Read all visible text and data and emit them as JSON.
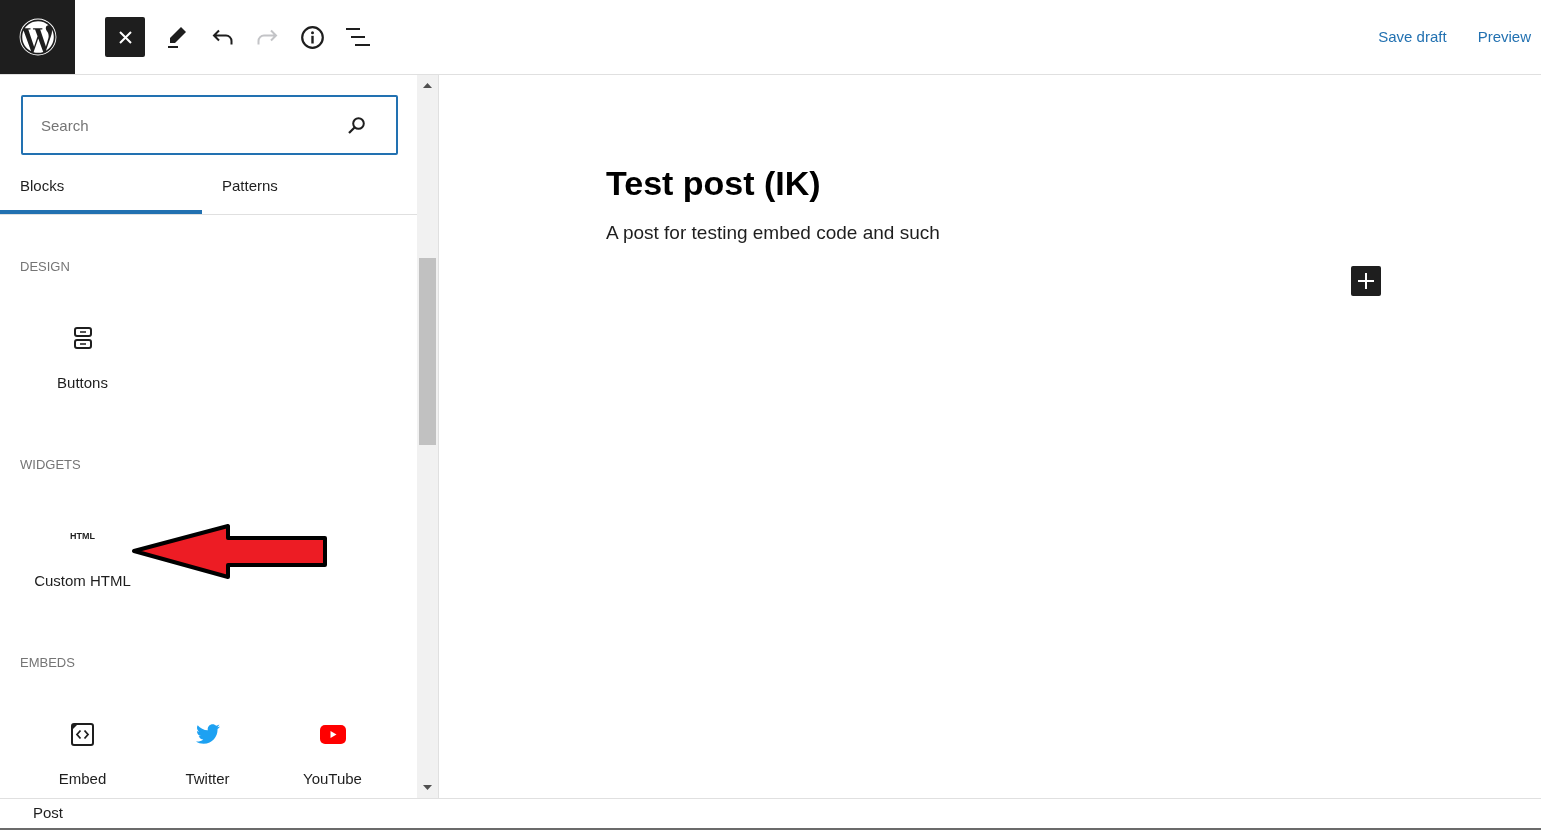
{
  "toolbar": {
    "inserter_toggle": {
      "active": true
    },
    "tools": [
      {
        "kind": "edit",
        "disabled": false
      },
      {
        "kind": "undo",
        "disabled": false
      },
      {
        "kind": "redo",
        "disabled": true
      },
      {
        "kind": "info",
        "disabled": false
      },
      {
        "kind": "list_view",
        "disabled": false
      }
    ],
    "actions": [
      "Save draft",
      "Preview"
    ]
  },
  "inserter": {
    "search": {
      "placeholder": "Search"
    },
    "tabs": [
      {
        "label": "Blocks",
        "selected": true
      },
      {
        "label": "Patterns",
        "selected": false
      }
    ],
    "sections": [
      {
        "title": "DESIGN",
        "blocks": [
          {
            "kind": "buttons",
            "label": "Buttons"
          }
        ]
      },
      {
        "title": "WIDGETS",
        "blocks": [
          {
            "kind": "html",
            "icon_text": "HTML",
            "label": "Custom HTML"
          }
        ]
      },
      {
        "title": "EMBEDS",
        "blocks": [
          {
            "kind": "embed",
            "label": "Embed"
          },
          {
            "kind": "twitter",
            "label": "Twitter"
          },
          {
            "kind": "youtube",
            "label": "YouTube"
          }
        ]
      }
    ]
  },
  "editor": {
    "title": "Test post (IK)",
    "paragraph": "A post for testing embed code and such"
  },
  "status_bar": {
    "breadcrumb": "Post"
  }
}
